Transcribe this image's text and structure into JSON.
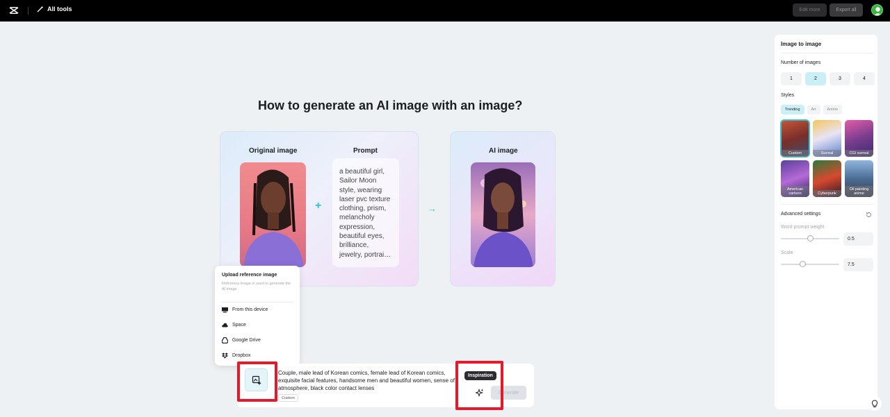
{
  "topbar": {
    "all_tools_label": "All tools",
    "edit_more_label": "Edit more",
    "export_all_label": "Export all"
  },
  "main": {
    "heading": "How to generate an AI image with an image?",
    "original_label": "Original image",
    "prompt_label": "Prompt",
    "prompt_example": "a beautiful girl, Sailor Moon style, wearing laser pvc texture clothing, prism, melancholy expression, beautiful eyes, brilliance, jewelry, portrai…",
    "ai_label": "AI image"
  },
  "upload_popover": {
    "title": "Upload reference image",
    "subtitle": "Reference image is used to generate the AI image.",
    "items": [
      {
        "label": "From this device",
        "icon": "device-icon"
      },
      {
        "label": "Space",
        "icon": "cloud-icon"
      },
      {
        "label": "Google Drive",
        "icon": "google-drive-icon"
      },
      {
        "label": "Dropbox",
        "icon": "dropbox-icon"
      }
    ]
  },
  "input_bar": {
    "prompt_text": "Couple, male lead of Korean comics, female lead of Korean comics, exquisite facial features, handsome men and beautiful women, sense of atmosphere, black color contact lenses",
    "custom_tag": "Custom",
    "inspiration_tooltip": "Inspiration",
    "generate_label": "Generate"
  },
  "panel": {
    "title": "Image to image",
    "number_label": "Number of images",
    "numbers": [
      "1",
      "2",
      "3",
      "4"
    ],
    "selected_number": "2",
    "styles_label": "Styles",
    "style_tabs": [
      "Trending",
      "Art",
      "Anime"
    ],
    "active_tab": "Trending",
    "styles": [
      {
        "name": "Custom",
        "selected": true
      },
      {
        "name": "Surreal",
        "selected": false
      },
      {
        "name": "CGI surreal",
        "selected": false
      },
      {
        "name": "American cartoon",
        "selected": false
      },
      {
        "name": "Cyberpunk",
        "selected": false
      },
      {
        "name": "Oil painting anime",
        "selected": false
      }
    ],
    "advanced_label": "Advanced settings",
    "word_weight_label": "Word prompt weight",
    "word_weight_value": "0.5",
    "scale_label": "Scale",
    "scale_value": "7.5"
  },
  "colors": {
    "accent": "#2ec5d3",
    "highlight": "#e6182a",
    "topbar": "#000000"
  }
}
